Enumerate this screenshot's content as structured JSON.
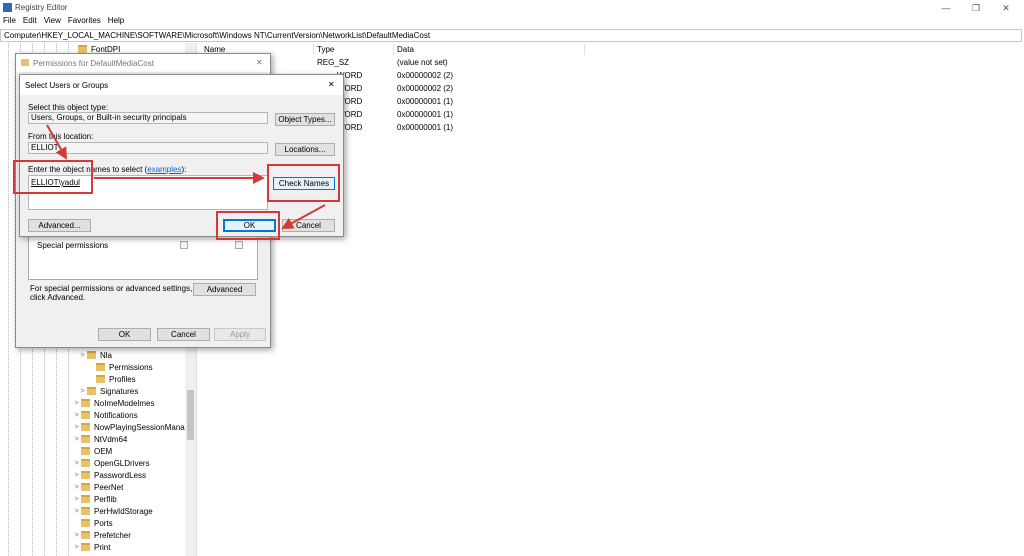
{
  "window": {
    "title": "Registry Editor",
    "minimize": "—",
    "restore": "❐",
    "close": "✕"
  },
  "menu": [
    "File",
    "Edit",
    "View",
    "Favorites",
    "Help"
  ],
  "address": "Computer\\HKEY_LOCAL_MACHINE\\SOFTWARE\\Microsoft\\Windows NT\\CurrentVersion\\NetworkList\\DefaultMediaCost",
  "tree": {
    "top_item": "FontDPI",
    "items": [
      {
        "label": "Nla",
        "expand": ">"
      },
      {
        "label": "Permissions",
        "expand": ""
      },
      {
        "label": "Profiles",
        "expand": ""
      },
      {
        "label": "Signatures",
        "expand": ">"
      },
      {
        "label": "NoImeModelmes",
        "expand": ">"
      },
      {
        "label": "Notifications",
        "expand": ">"
      },
      {
        "label": "NowPlayingSessionManage",
        "expand": ">"
      },
      {
        "label": "NtVdm64",
        "expand": ">"
      },
      {
        "label": "OEM",
        "expand": ""
      },
      {
        "label": "OpenGLDrivers",
        "expand": ">"
      },
      {
        "label": "PasswordLess",
        "expand": ">"
      },
      {
        "label": "PeerNet",
        "expand": ">"
      },
      {
        "label": "Perflib",
        "expand": ">"
      },
      {
        "label": "PerHwIdStorage",
        "expand": ">"
      },
      {
        "label": "Ports",
        "expand": ""
      },
      {
        "label": "Prefetcher",
        "expand": ">"
      },
      {
        "label": "Print",
        "expand": ">"
      }
    ]
  },
  "values_pane": {
    "headers": {
      "name": "Name",
      "type": "Type",
      "data": "Data"
    },
    "rows": [
      {
        "type": "REG_SZ",
        "data": "(value not set)"
      },
      {
        "type": "WORD",
        "data": "0x00000002 (2)"
      },
      {
        "type": "WORD",
        "data": "0x00000002 (2)"
      },
      {
        "type": "WORD",
        "data": "0x00000001 (1)"
      },
      {
        "type": "WORD",
        "data": "0x00000001 (1)"
      },
      {
        "type": "WORD",
        "data": "0x00000001 (1)"
      }
    ]
  },
  "permissions_dialog": {
    "title": "Permissions for DefaultMediaCost",
    "close": "✕",
    "special_permissions": "Special permissions",
    "advanced_note_1": "For special permissions or advanced settings,",
    "advanced_note_2": "click Advanced.",
    "advanced_button": "Advanced",
    "ok": "OK",
    "cancel": "Cancel",
    "apply": "Apply"
  },
  "select_dialog": {
    "title": "Select Users or Groups",
    "close": "✕",
    "object_type_label": "Select this object type:",
    "object_type_value": "Users, Groups, or Built-in security principals",
    "object_types_button": "Object Types...",
    "location_label": "From this location:",
    "location_value": "ELLIOT",
    "locations_button": "Locations...",
    "names_label": "Enter the object names to select",
    "examples_link": "examples",
    "names_value": "ELLIOT\\yadul",
    "check_names_button": "Check Names",
    "advanced_button": "Advanced...",
    "ok": "OK",
    "cancel": "Cancel"
  },
  "colors": {
    "highlight_red": "#d23a3a",
    "link_blue": "#0066cc",
    "folder_yellow": "#e8c16a"
  }
}
